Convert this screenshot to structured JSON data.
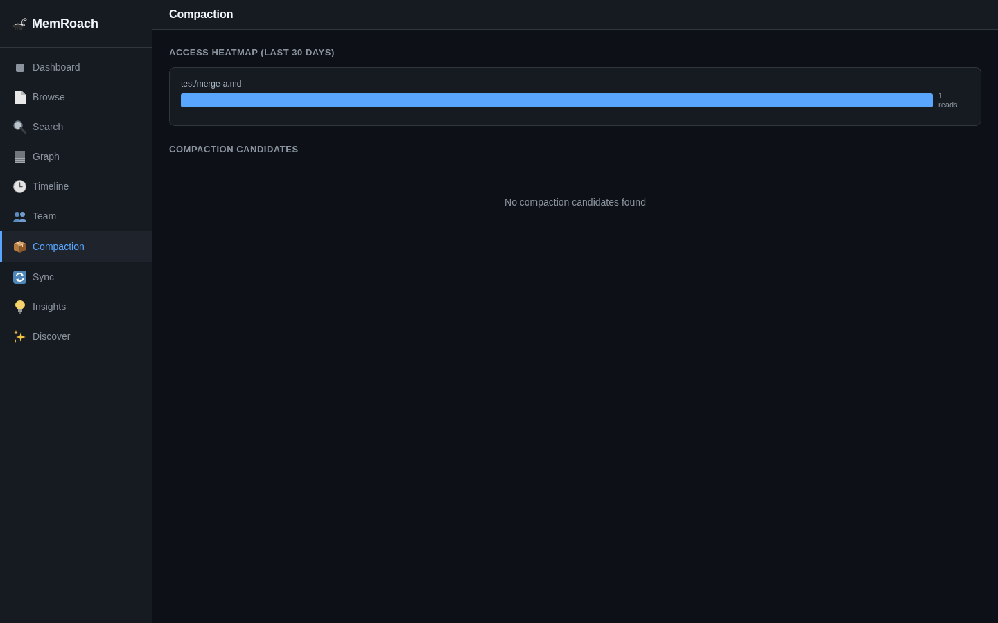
{
  "app": {
    "name": "MemRoach"
  },
  "sidebar": {
    "items": [
      {
        "label": "Dashboard",
        "selected": false
      },
      {
        "label": "Browse",
        "selected": false
      },
      {
        "label": "Search",
        "selected": false
      },
      {
        "label": "Graph",
        "selected": false
      },
      {
        "label": "Timeline",
        "selected": false
      },
      {
        "label": "Team",
        "selected": false
      },
      {
        "label": "Compaction",
        "selected": true
      },
      {
        "label": "Sync",
        "selected": false
      },
      {
        "label": "Insights",
        "selected": false
      },
      {
        "label": "Discover",
        "selected": false
      }
    ]
  },
  "header": {
    "title": "Compaction"
  },
  "heatmap": {
    "title": "ACCESS HEATMAP (LAST 30 DAYS)",
    "rows": [
      {
        "file": "test/merge-a.md",
        "reading": "1 reads"
      }
    ]
  },
  "candidates": {
    "title": "COMPACTION CANDIDATES",
    "empty_message": "No compaction candidates found"
  }
}
